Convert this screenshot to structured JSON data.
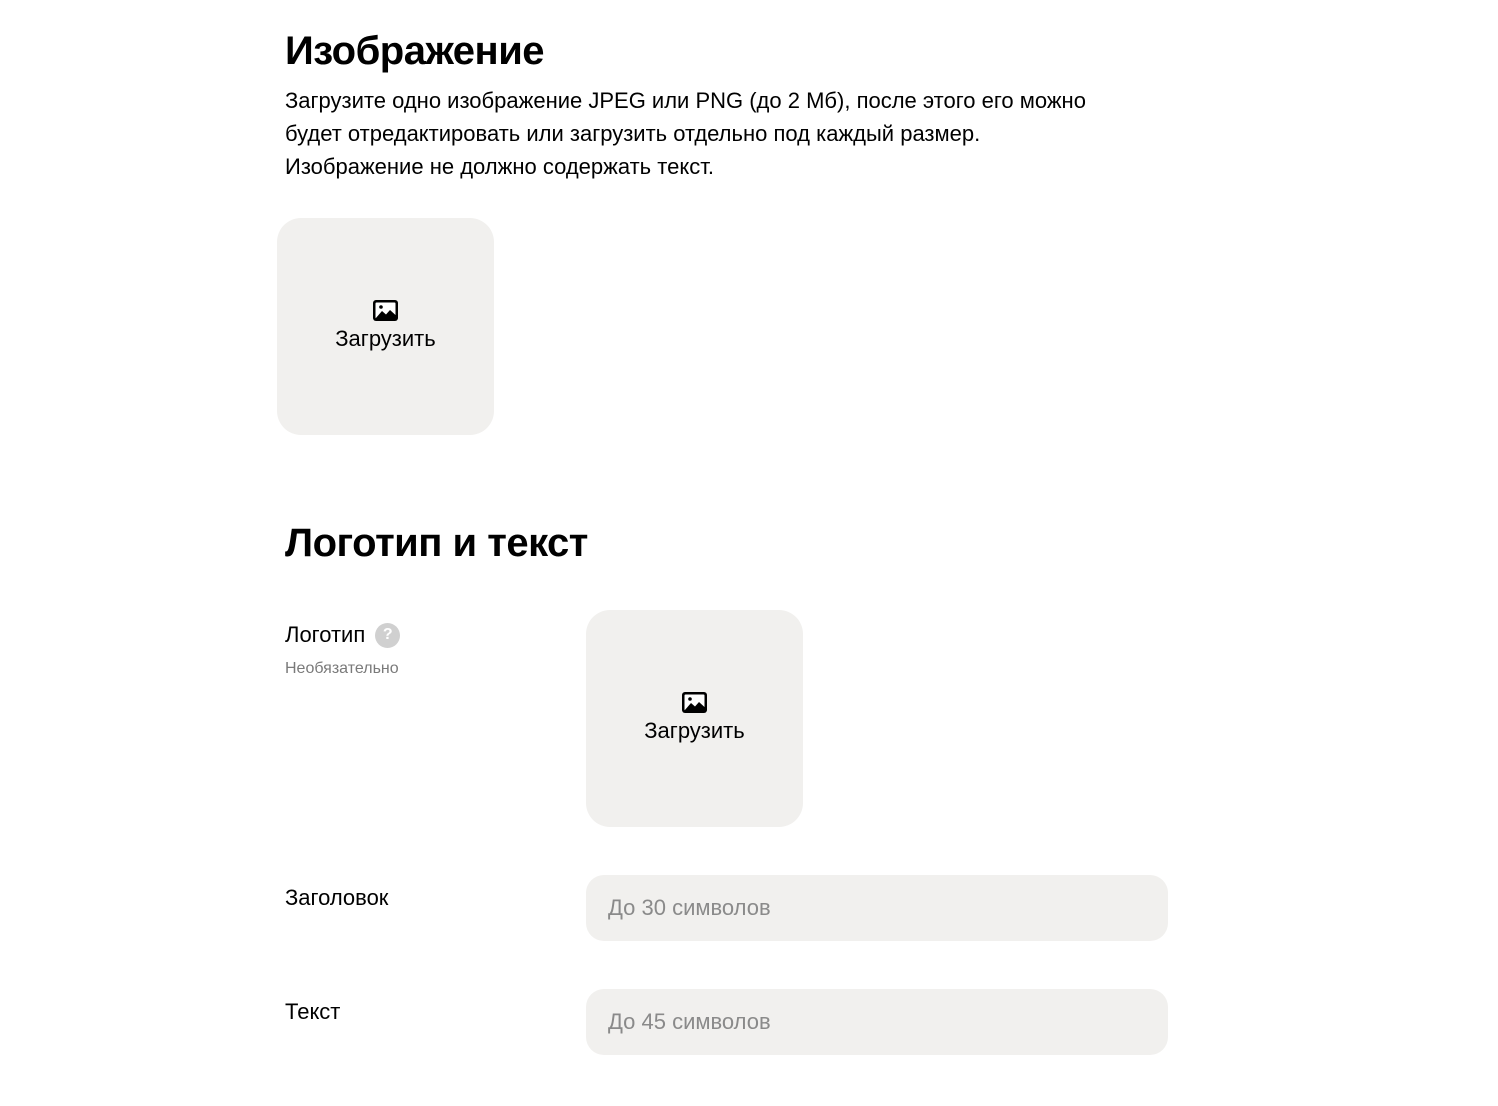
{
  "image_section": {
    "title": "Изображение",
    "description_lines": [
      "Загрузите одно изображение JPEG или PNG (до 2 Мб), после этого его можно",
      "будет отредактировать или загрузить отдельно под каждый размер.",
      "Изображение не должно содержать текст."
    ],
    "upload": {
      "icon": "image-icon",
      "label": "Загрузить"
    }
  },
  "logo_section": {
    "title": "Логотип и текст",
    "logo": {
      "label": "Логотип",
      "help_icon": "question-icon",
      "help_glyph": "?",
      "hint": "Необязательно",
      "upload": {
        "icon": "image-icon",
        "label": "Загрузить"
      }
    },
    "headline": {
      "label": "Заголовок",
      "value": "",
      "placeholder": "До 30 символов"
    },
    "text": {
      "label": "Текст",
      "value": "",
      "placeholder": "До 45 символов"
    }
  },
  "colors": {
    "tile_background": "#f1f0ee",
    "placeholder_text": "#8a8a8a",
    "hint_text": "#7a7a7a",
    "help_icon_background": "#d0d0d0"
  }
}
